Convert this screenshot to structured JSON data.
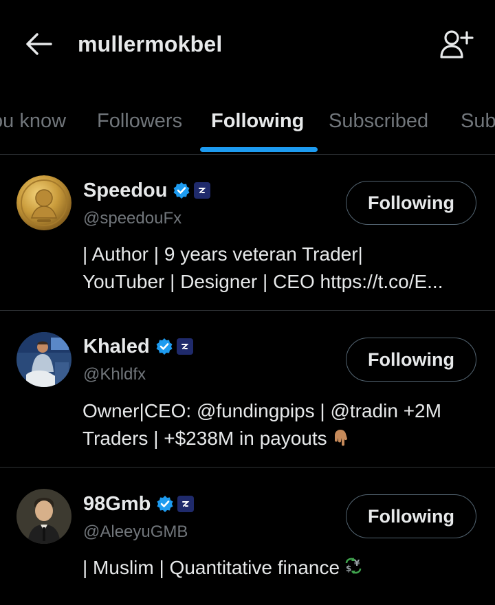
{
  "header": {
    "title": "mullermokbel"
  },
  "tabs": [
    {
      "label": "ou know",
      "active": false
    },
    {
      "label": "Followers",
      "active": false
    },
    {
      "label": "Following",
      "active": true
    },
    {
      "label": "Subscribed",
      "active": false
    },
    {
      "label": "Sub",
      "active": false
    }
  ],
  "colors": {
    "background": "#000000",
    "accent": "#1d9bf0",
    "primary_text": "#e7e9ea",
    "secondary_text": "#71767b",
    "divider": "#2f3336",
    "verified_badge": "#1d9bf0",
    "affiliate_badge": "#1f2a6b"
  },
  "users": [
    {
      "name": "Speedou",
      "handle": "@speedouFx",
      "verified": true,
      "follow_label": "Following",
      "bio_lines": [
        "| Author | 9 years veteran Trader|",
        "YouTuber | Designer | CEO https://t.co/E..."
      ],
      "avatar_icon": "gold-coin-avatar"
    },
    {
      "name": "Khaled",
      "handle": "@Khldfx",
      "verified": true,
      "follow_label": "Following",
      "bio_lines": [
        "Owner|CEO: @fundingpips | @tradin +2M",
        "Traders | +$238M in payouts"
      ],
      "bio_emoji": "backhand-index-pointing-down-emoji",
      "avatar_icon": "person-photo-avatar"
    },
    {
      "name": "98Gmb",
      "handle": "@AleeyuGMB",
      "verified": true,
      "follow_label": "Following",
      "bio_lines": [
        "| Muslim | Quantitative finance"
      ],
      "bio_emoji": "currency-exchange-emoji",
      "avatar_icon": "illustrated-man-avatar"
    }
  ]
}
